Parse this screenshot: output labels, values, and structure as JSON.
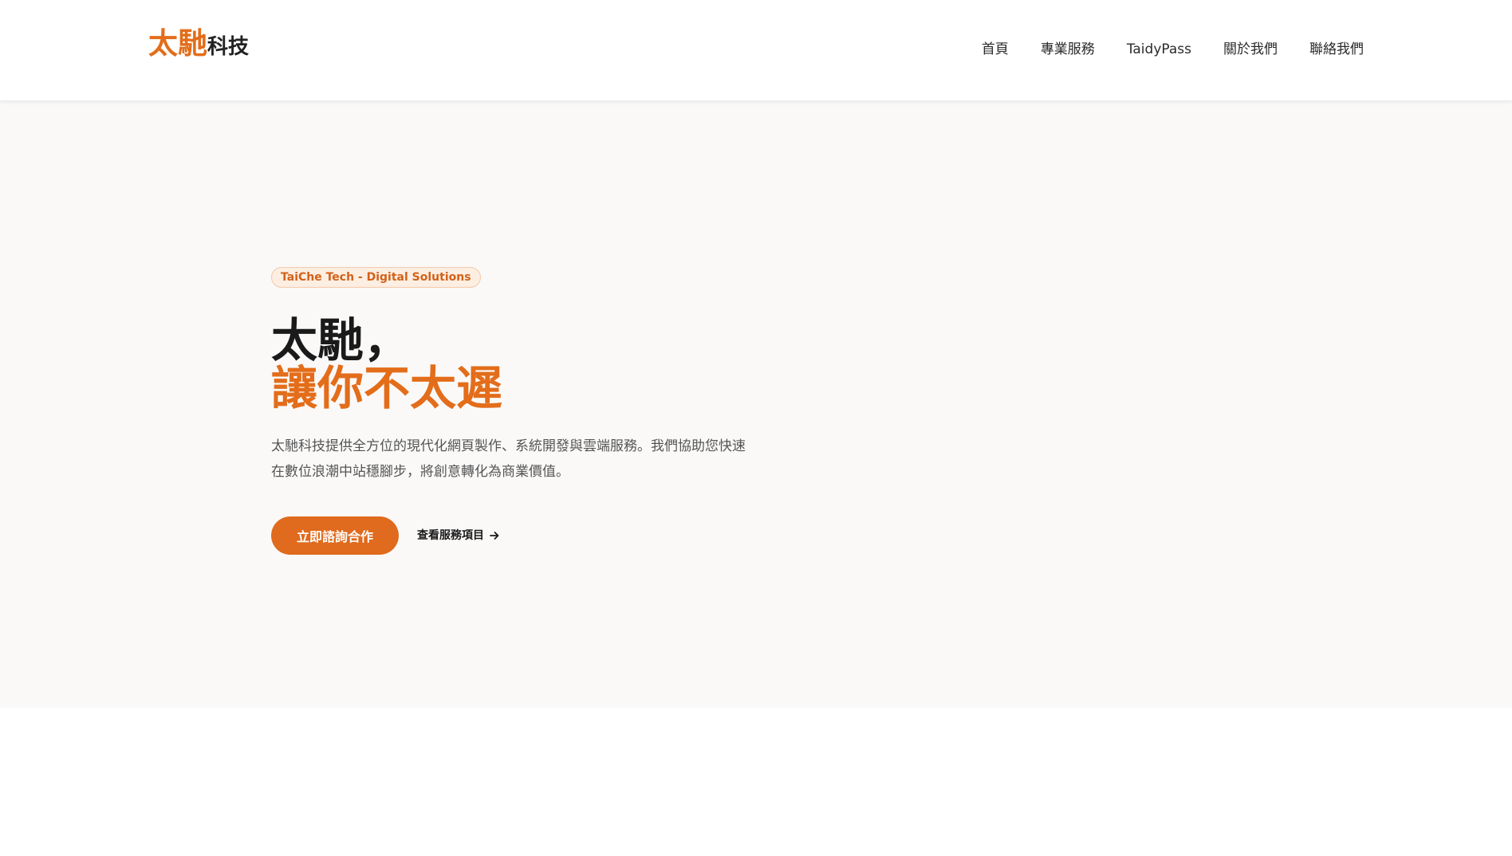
{
  "header": {
    "logo_brand": "太馳",
    "logo_tail": "科技",
    "nav": [
      "首頁",
      "專業服務",
      "TaidyPass",
      "關於我們",
      "聯絡我們"
    ]
  },
  "hero": {
    "badge": "TaiChe Tech - Digital Solutions",
    "headline_line1": "太馳，",
    "headline_line2": "讓你不太遲",
    "description": "太馳科技提供全方位的現代化網頁製作、系統開發與雲端服務。我們協助您快速在數位浪潮中站穩腳步，將創意轉化為商業價值。",
    "cta_label": "立即諮詢合作",
    "link_label": "查看服務項目",
    "link_icon": "arrow-right-icon"
  },
  "colors": {
    "accent": "#e36d1a",
    "hero_background": "#faf9f8",
    "text_dark": "#1a1a1a",
    "text_muted": "#555555"
  }
}
